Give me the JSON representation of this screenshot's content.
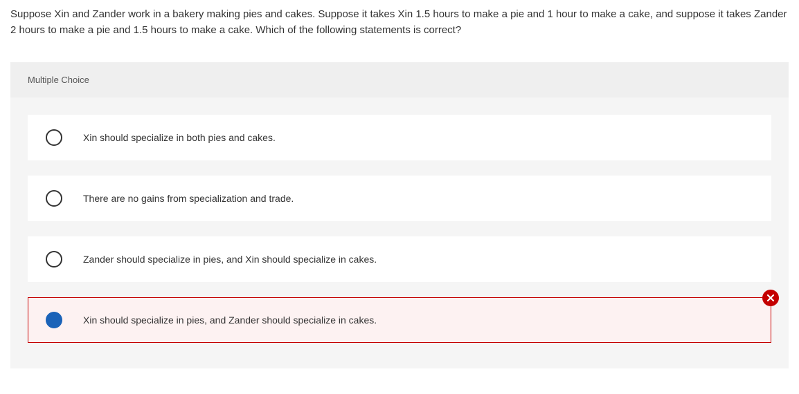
{
  "question": "Suppose Xin and Zander work in a bakery making pies and cakes. Suppose it takes Xin 1.5 hours to make a pie and 1 hour to make a cake, and suppose it takes Zander 2 hours to make a pie and 1.5 hours to make a cake. Which of the following statements is correct?",
  "mc_label": "Multiple Choice",
  "options": [
    {
      "text": "Xin should specialize in both pies and cakes.",
      "selected": false,
      "incorrect": false
    },
    {
      "text": "There are no gains from specialization and trade.",
      "selected": false,
      "incorrect": false
    },
    {
      "text": "Zander should specialize in pies, and Xin should specialize in cakes.",
      "selected": false,
      "incorrect": false
    },
    {
      "text": "Xin should specialize in pies, and Zander should specialize in cakes.",
      "selected": true,
      "incorrect": true
    }
  ]
}
